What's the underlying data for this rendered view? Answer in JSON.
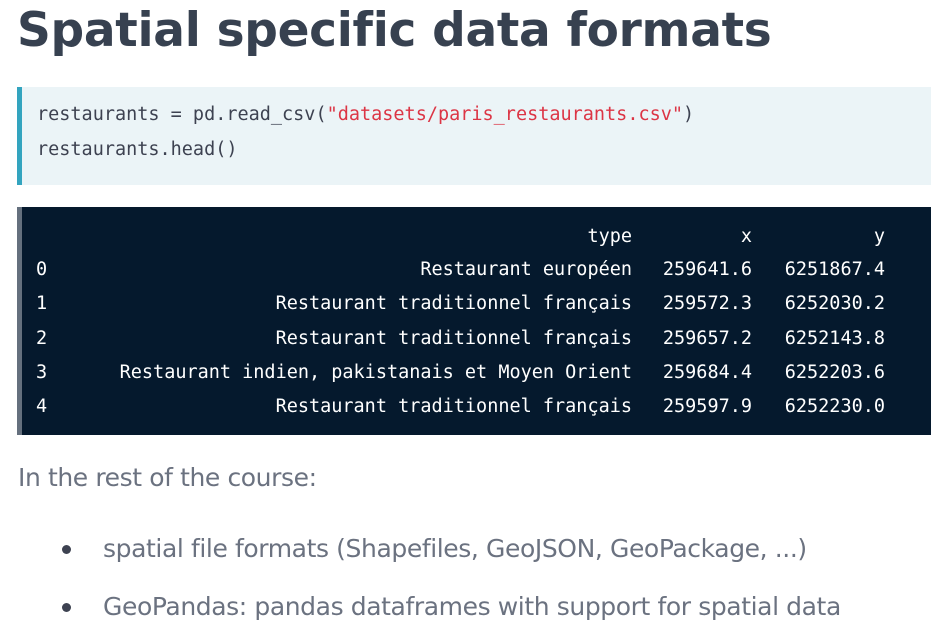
{
  "slide": {
    "title": "Spatial specific data formats"
  },
  "code_input": {
    "line1": {
      "prefix": "restaurants = pd.read_csv(",
      "string": "\"datasets/paris_restaurants.csv\"",
      "suffix": ")"
    },
    "line2": "restaurants.head()"
  },
  "dataframe_output": {
    "columns": [
      "type",
      "x",
      "y"
    ],
    "rows": [
      {
        "index": "0",
        "type": "Restaurant européen",
        "x": "259641.6",
        "y": "6251867.4"
      },
      {
        "index": "1",
        "type": "Restaurant traditionnel français",
        "x": "259572.3",
        "y": "6252030.2"
      },
      {
        "index": "2",
        "type": "Restaurant traditionnel français",
        "x": "259657.2",
        "y": "6252143.8"
      },
      {
        "index": "3",
        "type": "Restaurant indien, pakistanais et Moyen Orient",
        "x": "259684.4",
        "y": "6252203.6"
      },
      {
        "index": "4",
        "type": "Restaurant traditionnel français",
        "x": "259597.9",
        "y": "6252230.0"
      }
    ]
  },
  "body": {
    "intro": "In the rest of the course:",
    "bullets": [
      "spatial file formats (Shapefiles, GeoJSON, GeoPackage, ...)",
      "GeoPandas: pandas dataframes with support for spatial data"
    ]
  },
  "colors": {
    "title": "#374150",
    "code_background": "#ebf4f7",
    "code_accent": "#33a4bf",
    "string_literal": "#dc3545",
    "output_background": "#05192d",
    "output_accent": "#65707e",
    "body_text": "#6b7280"
  }
}
